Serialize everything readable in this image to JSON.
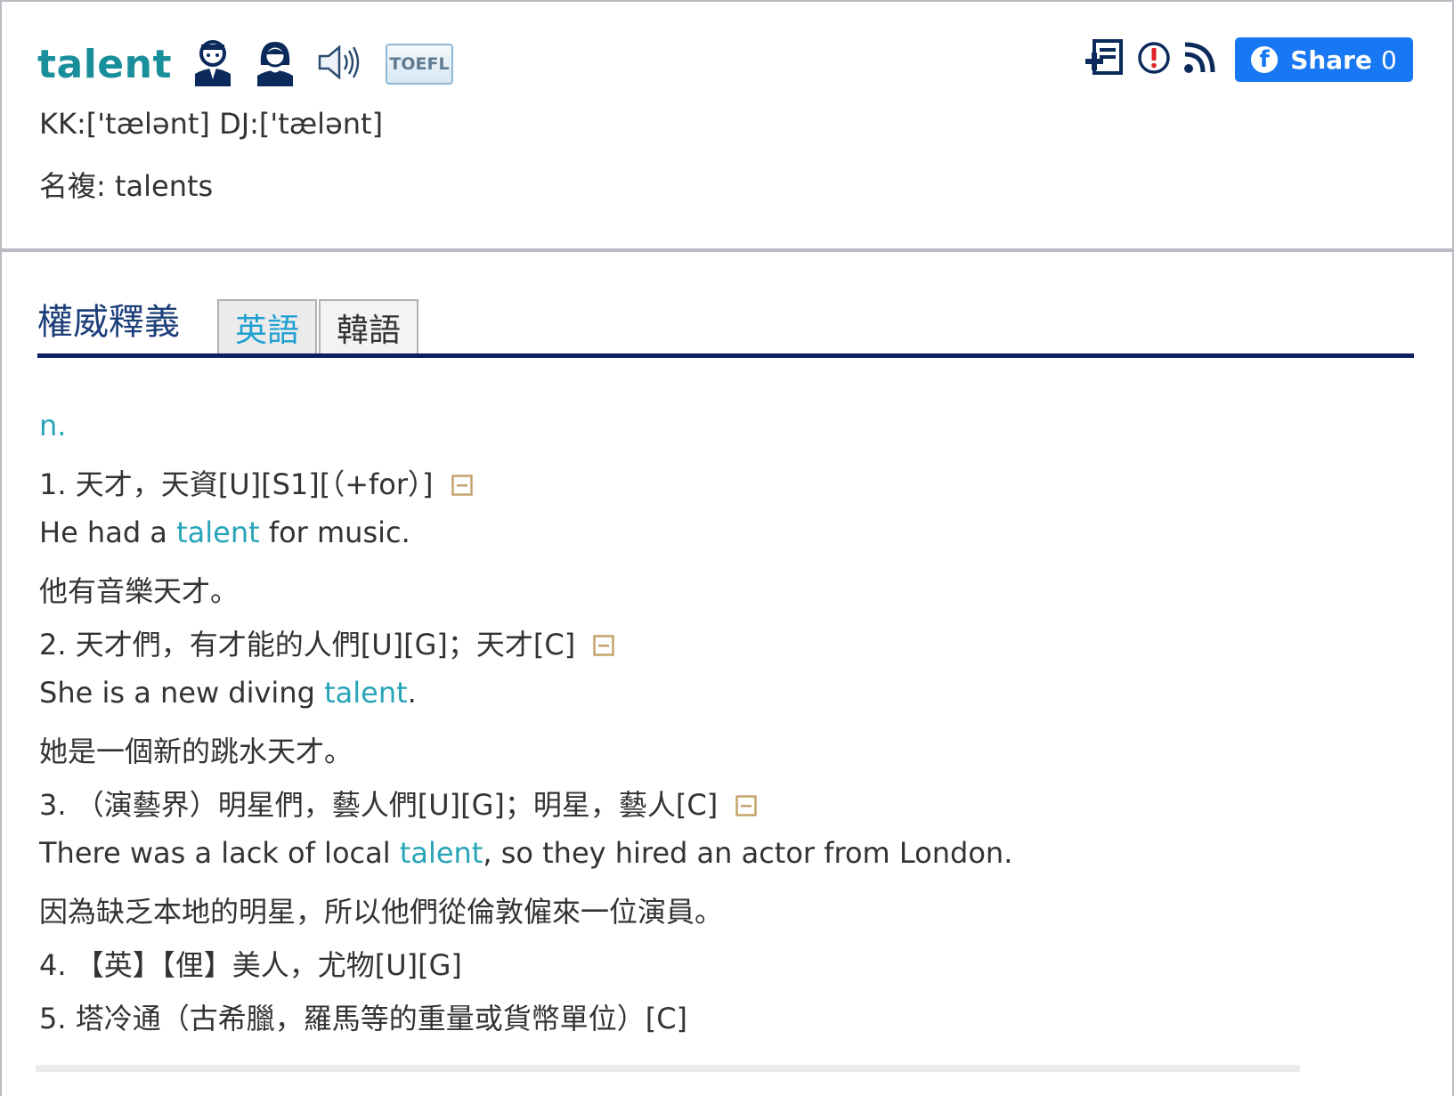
{
  "header": {
    "word": "talent",
    "toefl_label": "TOEFL",
    "phonetic": "KK:['tælənt] DJ:['tælənt]",
    "plural": "名複: talents",
    "share": {
      "label": "Share",
      "count": "0"
    }
  },
  "section": {
    "title": "權威釋義",
    "tabs": [
      {
        "label": "英語",
        "active": true
      },
      {
        "label": "韓語",
        "active": false
      }
    ]
  },
  "definitions": {
    "pos": "n.",
    "items": [
      {
        "definition": "1. 天才，天資[U][S1][（+for）]",
        "example_before": "He had a ",
        "example_keyword": "talent",
        "example_after": " for music.",
        "translation": "他有音樂天才。"
      },
      {
        "definition": "2. 天才們，有才能的人們[U][G]；天才[C]",
        "example_before": "She is a new diving ",
        "example_keyword": "talent",
        "example_after": ".",
        "translation": "她是一個新的跳水天才。"
      },
      {
        "definition": "3. （演藝界）明星們，藝人們[U][G]；明星，藝人[C]",
        "example_before": "There was a lack of local ",
        "example_keyword": "talent",
        "example_after": ", so they hired an actor from London.",
        "translation": "因為缺乏本地的明星，所以他們從倫敦僱來一位演員。"
      },
      {
        "definition": "4. 【英】【俚】美人，尤物[U][G]"
      },
      {
        "definition": "5. 塔冷通（古希臘，羅馬等的重量或貨幣單位）[C]"
      }
    ]
  },
  "colors": {
    "word": "#1a8f9c",
    "keyword": "#27a4b8",
    "section_title": "#1c3f7a",
    "rule": "#0d1f63",
    "share_bg": "#1877f2"
  }
}
